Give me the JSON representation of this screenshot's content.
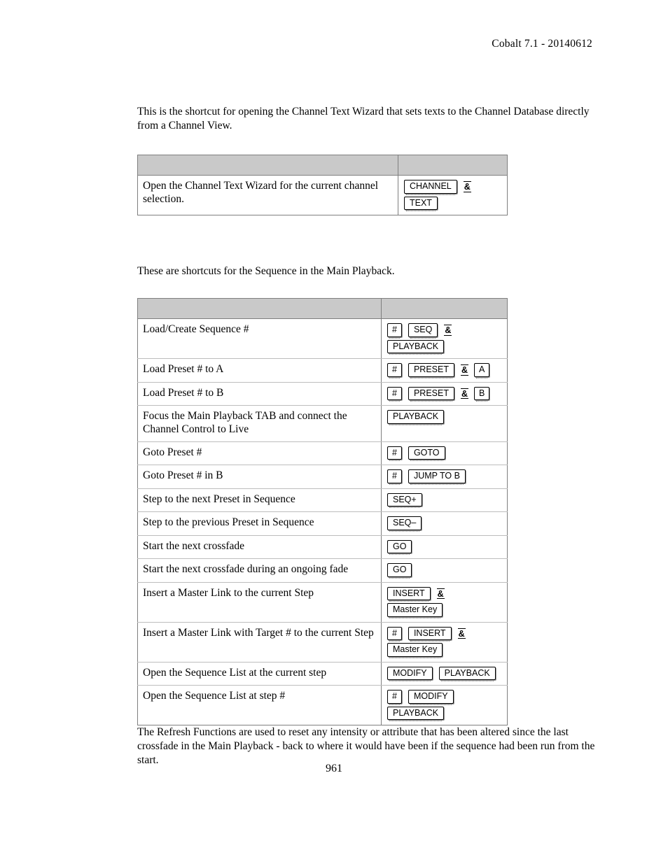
{
  "header": {
    "running_head": "Cobalt 7.1 - 20140612"
  },
  "intro_paragraph": "This is the shortcut for opening the Channel Text Wizard that sets texts to the Channel Database directly from a Channel View.",
  "channel_table": {
    "header_cells": [
      "",
      ""
    ],
    "rows": [
      {
        "description": "Open the Channel Text Wizard for the current channel selection.",
        "key_lines": [
          [
            {
              "type": "key",
              "label": "CHANNEL"
            },
            {
              "type": "amp",
              "label": "&"
            }
          ],
          [
            {
              "type": "key",
              "label": "TEXT"
            }
          ]
        ]
      }
    ]
  },
  "sequence_paragraph": "These are shortcuts for the Sequence in the Main Playback.",
  "sequence_table": {
    "header_cells": [
      "",
      ""
    ],
    "rows": [
      {
        "description": "Load/Create Sequence #",
        "key_lines": [
          [
            {
              "type": "key",
              "label": "#",
              "narrow": true
            },
            {
              "type": "key",
              "label": "SEQ"
            },
            {
              "type": "amp",
              "label": "&"
            }
          ],
          [
            {
              "type": "key",
              "label": "PLAYBACK"
            }
          ]
        ]
      },
      {
        "description": "Load Preset # to A",
        "key_lines": [
          [
            {
              "type": "key",
              "label": "#",
              "narrow": true
            },
            {
              "type": "key",
              "label": "PRESET"
            },
            {
              "type": "amp",
              "label": "&"
            },
            {
              "type": "key",
              "label": "A",
              "narrow": true
            }
          ]
        ]
      },
      {
        "description": "Load Preset # to B",
        "key_lines": [
          [
            {
              "type": "key",
              "label": "#",
              "narrow": true
            },
            {
              "type": "key",
              "label": "PRESET"
            },
            {
              "type": "amp",
              "label": "&"
            },
            {
              "type": "key",
              "label": "B",
              "narrow": true
            }
          ]
        ]
      },
      {
        "description": "Focus the Main Playback TAB and connect the Channel Control to Live",
        "key_lines": [
          [
            {
              "type": "key",
              "label": "PLAYBACK"
            }
          ]
        ]
      },
      {
        "description": "Goto Preset #",
        "key_lines": [
          [
            {
              "type": "key",
              "label": "#",
              "narrow": true
            },
            {
              "type": "key",
              "label": "GOTO"
            }
          ]
        ]
      },
      {
        "description": "Goto Preset # in B",
        "key_lines": [
          [
            {
              "type": "key",
              "label": "#",
              "narrow": true
            },
            {
              "type": "key",
              "label": "JUMP TO B"
            }
          ]
        ]
      },
      {
        "description": "Step to the next Preset in Sequence",
        "key_lines": [
          [
            {
              "type": "key",
              "label": "SEQ+"
            }
          ]
        ]
      },
      {
        "description": "Step to the previous Preset in Sequence",
        "key_lines": [
          [
            {
              "type": "key",
              "label": "SEQ–"
            }
          ]
        ]
      },
      {
        "description": "Start the next crossfade",
        "key_lines": [
          [
            {
              "type": "key",
              "label": "GO"
            }
          ]
        ]
      },
      {
        "description": "Start the next crossfade during an ongoing fade",
        "key_lines": [
          [
            {
              "type": "key",
              "label": "GO"
            }
          ]
        ]
      },
      {
        "description": "Insert a Master Link to the current Step",
        "key_lines": [
          [
            {
              "type": "key",
              "label": "INSERT"
            },
            {
              "type": "amp",
              "label": "&"
            }
          ],
          [
            {
              "type": "key",
              "label": "Master Key"
            }
          ]
        ]
      },
      {
        "description": "Insert a Master Link with Target # to the current Step",
        "key_lines": [
          [
            {
              "type": "key",
              "label": "#",
              "narrow": true
            },
            {
              "type": "key",
              "label": "INSERT"
            },
            {
              "type": "amp",
              "label": "&"
            }
          ],
          [
            {
              "type": "key",
              "label": "Master Key"
            }
          ]
        ]
      },
      {
        "description": "Open the Sequence List at the current step",
        "key_lines": [
          [
            {
              "type": "key",
              "label": "MODIFY"
            },
            {
              "type": "key",
              "label": "PLAYBACK"
            }
          ]
        ]
      },
      {
        "description": "Open the Sequence List at step #",
        "key_lines": [
          [
            {
              "type": "key",
              "label": "#",
              "narrow": true
            },
            {
              "type": "key",
              "label": "MODIFY"
            }
          ],
          [
            {
              "type": "key",
              "label": "PLAYBACK"
            }
          ]
        ]
      }
    ]
  },
  "refresh_paragraph": "The Refresh Functions are used to reset any intensity or attribute that has been altered since the last crossfade in the Main Playback - back to where it would have been if the sequence had been run from the start.",
  "folio": "961",
  "colors": {
    "table_header_fill": "#c9c9c9",
    "table_border": "#7f7f7f",
    "row_divider": "#bdbdbd",
    "text": "#000000",
    "page_background": "#ffffff"
  }
}
